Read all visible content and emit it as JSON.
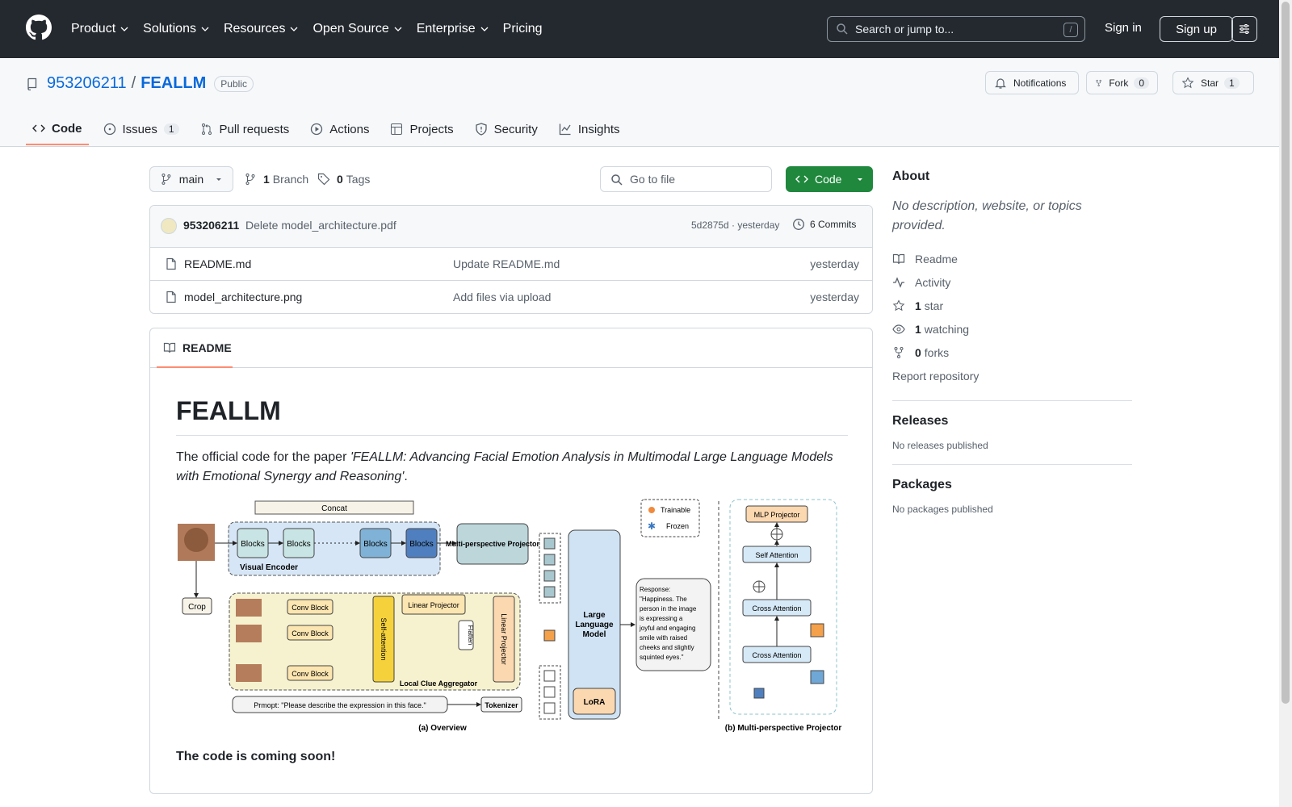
{
  "header": {
    "nav": [
      "Product",
      "Solutions",
      "Resources",
      "Open Source",
      "Enterprise",
      "Pricing"
    ],
    "search_placeholder": "Search or jump to...",
    "search_shortcut": "/",
    "signin": "Sign in",
    "signup": "Sign up"
  },
  "repo": {
    "owner": "953206211",
    "separator": "/",
    "name": "FEALLM",
    "visibility": "Public",
    "notifications": "Notifications",
    "fork_label": "Fork",
    "fork_count": "0",
    "star_label": "Star",
    "star_count": "1"
  },
  "tabs": [
    {
      "label": "Code"
    },
    {
      "label": "Issues",
      "count": "1"
    },
    {
      "label": "Pull requests"
    },
    {
      "label": "Actions"
    },
    {
      "label": "Projects"
    },
    {
      "label": "Security"
    },
    {
      "label": "Insights"
    }
  ],
  "toolbar": {
    "branch": "main",
    "branch_count": "1",
    "branch_label": "Branch",
    "tag_count": "0",
    "tag_label": "Tags",
    "goto_placeholder": "Go to file",
    "code_button": "Code"
  },
  "commit": {
    "author": "953206211",
    "message": "Delete model_architecture.pdf",
    "hash_time": "5d2875d · yesterday",
    "commits": "6 Commits"
  },
  "files": [
    {
      "name": "README.md",
      "message": "Update README.md",
      "time": "yesterday"
    },
    {
      "name": "model_architecture.png",
      "message": "Add files via upload",
      "time": "yesterday"
    }
  ],
  "readme": {
    "tab": "README",
    "title": "FEALLM",
    "intro": "The official code for the paper ",
    "paper_title": "'FEALLM: Advancing Facial Emotion Analysis in Multimodal Large Language Models with Emotional Synergy and Reasoning'",
    "intro_end": ".",
    "coming_soon": "The code is coming soon!",
    "figure": {
      "concat": "Concat",
      "blocks": "Blocks",
      "visual_encoder": "Visual Encoder",
      "mpp": "Multi-perspective Projector",
      "trainable": "Trainable",
      "frozen": "Frozen",
      "crop": "Crop",
      "conv_block": "Conv Block",
      "self_attention_v": "Self-attention",
      "linear_projector": "Linear Projector",
      "flatten": "Flatten",
      "lca": "Local Clue Aggregator",
      "llm": [
        "Large",
        "Language",
        "Model"
      ],
      "lora": "LoRA",
      "response": [
        "Response:",
        "\"Happiness. The",
        "person in the image",
        "is expressing a",
        "joyful and engaging",
        "smile with raised",
        "cheeks and slightly",
        "squinted eyes.\""
      ],
      "prompt": "Prmopt: \"Please describe the expression in this face.\"",
      "tokenizer": "Tokenizer",
      "caption_a": "(a) Overview",
      "caption_b": "(b) Multi-perspective Projector",
      "mlp_projector": "MLP Projector",
      "self_attention": "Self Attention",
      "cross_attention": "Cross Attention"
    }
  },
  "about": {
    "title": "About",
    "description": "No description, website, or topics provided.",
    "readme": "Readme",
    "activity": "Activity",
    "stars_count": "1",
    "stars_label": "star",
    "watching_count": "1",
    "watching_label": "watching",
    "forks_count": "0",
    "forks_label": "forks",
    "report": "Report repository"
  },
  "releases": {
    "title": "Releases",
    "text": "No releases published"
  },
  "packages": {
    "title": "Packages",
    "text": "No packages published"
  },
  "colors": {
    "header_bg": "#24292f",
    "link": "#0969da",
    "code_button": "#1f883d",
    "active_tab": "#fd8c73"
  }
}
